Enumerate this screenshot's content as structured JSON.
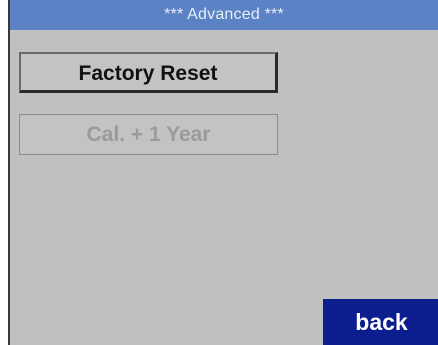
{
  "header": {
    "title": "*** Advanced ***"
  },
  "buttons": {
    "factory_reset_label": "Factory Reset",
    "calibration_label": "Cal. + 1 Year",
    "back_label": "back"
  },
  "colors": {
    "title_bar": "#5a82c4",
    "screen_background": "#c0c0c0",
    "back_button": "#0c1e8e",
    "disabled_text": "#9a9a9a"
  }
}
